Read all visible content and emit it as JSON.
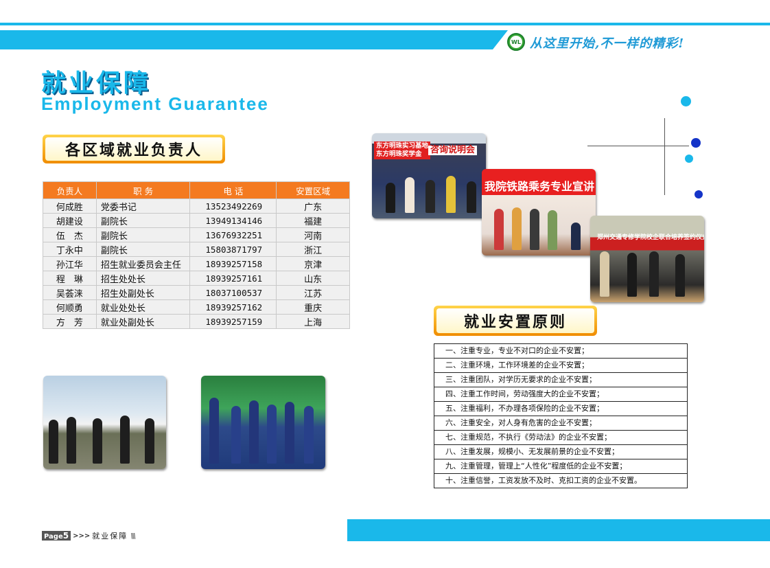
{
  "header": {
    "logo_text": "WL",
    "slogan": "从这里开始,不一样的精彩!"
  },
  "title": {
    "cn": "就业保障",
    "en": "Employment Guarantee"
  },
  "regions_section": {
    "heading": "各区域就业负责人",
    "columns": [
      "负责人",
      "职 务",
      "电 话",
      "安置区域"
    ],
    "rows": [
      {
        "name": "何成胜",
        "position": "党委书记",
        "phone": "13523492269",
        "region": "广东"
      },
      {
        "name": "胡建设",
        "position": "副院长",
        "phone": "13949134146",
        "region": "福建"
      },
      {
        "name": "伍　杰",
        "position": "副院长",
        "phone": "13676932251",
        "region": "河南"
      },
      {
        "name": "丁永中",
        "position": "副院长",
        "phone": "15803871797",
        "region": "浙江"
      },
      {
        "name": "孙江华",
        "position": "招生就业委员会主任",
        "phone": "18939257158",
        "region": "京津"
      },
      {
        "name": "程　琳",
        "position": "招生处处长",
        "phone": "18939257161",
        "region": "山东"
      },
      {
        "name": "吴荟涞",
        "position": "招生处副处长",
        "phone": "18037100537",
        "region": "江苏"
      },
      {
        "name": "何顺勇",
        "position": "就业处处长",
        "phone": "18939257162",
        "region": "重庆"
      },
      {
        "name": "方　芳",
        "position": "就业处副处长",
        "phone": "18939257159",
        "region": "上海"
      }
    ]
  },
  "photos": {
    "photo1_banner": "东方明珠实习基地\n东方明珠奖学金",
    "photo1_banner2": "咨询说明会",
    "photo2_banner": "我院铁路乘务专业宣讲",
    "photo3_banner": "郑州交通专修学院校企联合培养签约仪式"
  },
  "principles_section": {
    "heading": "就业安置原则",
    "items": [
      "一、注重专业，专业不对口的企业不安置；",
      "二、注重环境，工作环境差的企业不安置；",
      "三、注重团队，对学历无要求的企业不安置；",
      "四、注重工作时间，劳动强度大的企业不安置；",
      "五、注重福利，不办理各项保险的企业不安置；",
      "六、注重安全，对人身有危害的企业不安置；",
      "七、注重规范，不执行《劳动法》的企业不安置；",
      "八、注重发展，规模小、无发展前景的企业不安置；",
      "九、注重管理，管理上“人性化”程度低的企业不安置；",
      "十、注重信誉，工资发放不及时、克扣工资的企业不安置。"
    ]
  },
  "footer": {
    "page_prefix": "Page",
    "page_number": "5",
    "arrows": ">>>",
    "section_label": "就业保障",
    "slashes": "\\\\\\"
  },
  "colors": {
    "accent": "#1ab8ea",
    "table_header": "#f47a20",
    "badge": "#f5a000",
    "dot_dark": "#1434c8"
  }
}
